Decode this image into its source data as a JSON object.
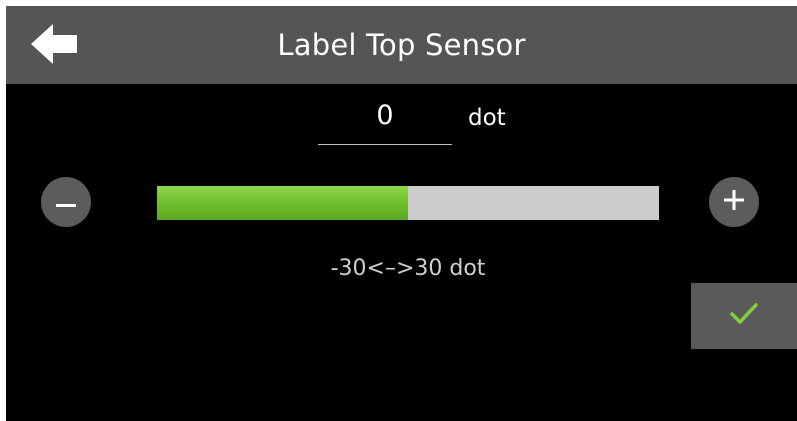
{
  "header": {
    "title": "Label Top Sensor",
    "back_icon": "arrow-left-icon"
  },
  "value": {
    "current": "0",
    "unit": "dot"
  },
  "slider": {
    "fill_fraction": 0.5,
    "fill_color": "#6cbd2a",
    "track_color": "#cccccc",
    "minus_icon": "minus-icon",
    "plus_icon": "plus-icon"
  },
  "range_label": "-30<–>30 dot",
  "confirm": {
    "icon": "checkmark-icon",
    "color": "#7fd13a"
  }
}
